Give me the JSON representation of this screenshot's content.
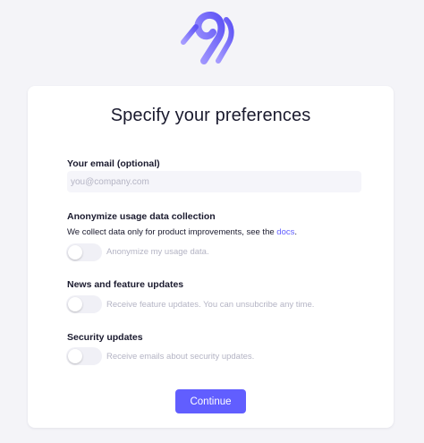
{
  "logo": {
    "icon": "airbyte-logo-icon",
    "color": "#615eff"
  },
  "title": "Specify your preferences",
  "email": {
    "label": "Your email (optional)",
    "placeholder": "you@company.com",
    "value": ""
  },
  "anonymize": {
    "label": "Anonymize usage data collection",
    "description": "We collect data only for product improvements, see the",
    "link_text": "docs",
    "description_end": ".",
    "toggle_label": "Anonymize my usage data.",
    "enabled": false
  },
  "news": {
    "label": "News and feature updates",
    "toggle_label": "Receive feature updates. You can unsubcribe any time.",
    "enabled": false
  },
  "security": {
    "label": "Security updates",
    "toggle_label": "Receive emails about security updates.",
    "enabled": false
  },
  "continue_label": "Continue",
  "colors": {
    "accent": "#615eff",
    "background": "#f4f4f8",
    "card": "#ffffff",
    "muted_text": "#b4b4c4"
  }
}
